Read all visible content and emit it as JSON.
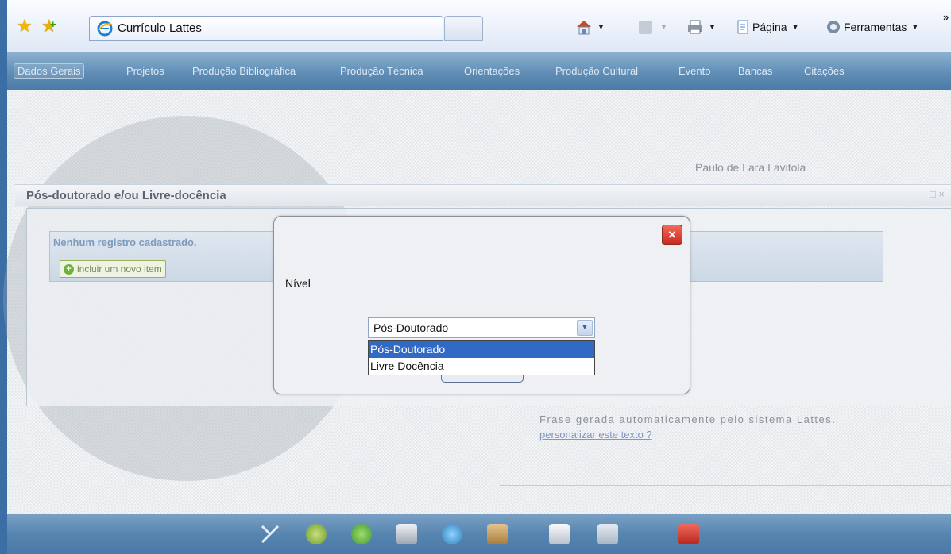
{
  "browser": {
    "tab_title": "Currículo Lattes",
    "page_menu_label": "Página",
    "tools_menu_label": "Ferramentas",
    "more_label": "»"
  },
  "nav": {
    "items": [
      "Dados Gerais",
      "Projetos",
      "Produção Bibliográfica",
      "Produção Técnica",
      "Orientações",
      "Produção Cultural",
      "Evento",
      "Bancas",
      "Citações"
    ]
  },
  "profile": {
    "name": "Paulo de Lara Lavitola"
  },
  "background": {
    "description_fragment": "Frase gerada automaticamente pelo sistema Lattes.",
    "customize_link": "personalizar este texto ?"
  },
  "panel": {
    "title": "Pós-doutorado e/ou Livre-docência",
    "controls": "□ ×",
    "empty_message": "Nenhum registro cadastrado.",
    "add_item_label": "incluir um novo item"
  },
  "dialog": {
    "close_label": "×",
    "nivel_label": "Nível",
    "select_value": "Pós-Doutorado",
    "options": [
      "Pós-Doutorado",
      "Livre Docência"
    ]
  },
  "colors": {
    "nav_bar": "#5f8db5",
    "selected_option": "#316ac5",
    "close_button": "#d9392b",
    "add_icon": "#6cb33a"
  },
  "icons": {
    "toolbar": [
      "favorites-star-icon",
      "add-favorites-icon",
      "ie-logo-icon",
      "home-icon",
      "rss-feed-icon",
      "print-icon",
      "page-icon",
      "gear-icon"
    ],
    "bottom_bar": [
      "tools-icon",
      "globe-icon",
      "refresh-icon",
      "print-icon",
      "web-icon",
      "users-icon",
      "document-icon",
      "copy-icon",
      "power-icon"
    ]
  }
}
